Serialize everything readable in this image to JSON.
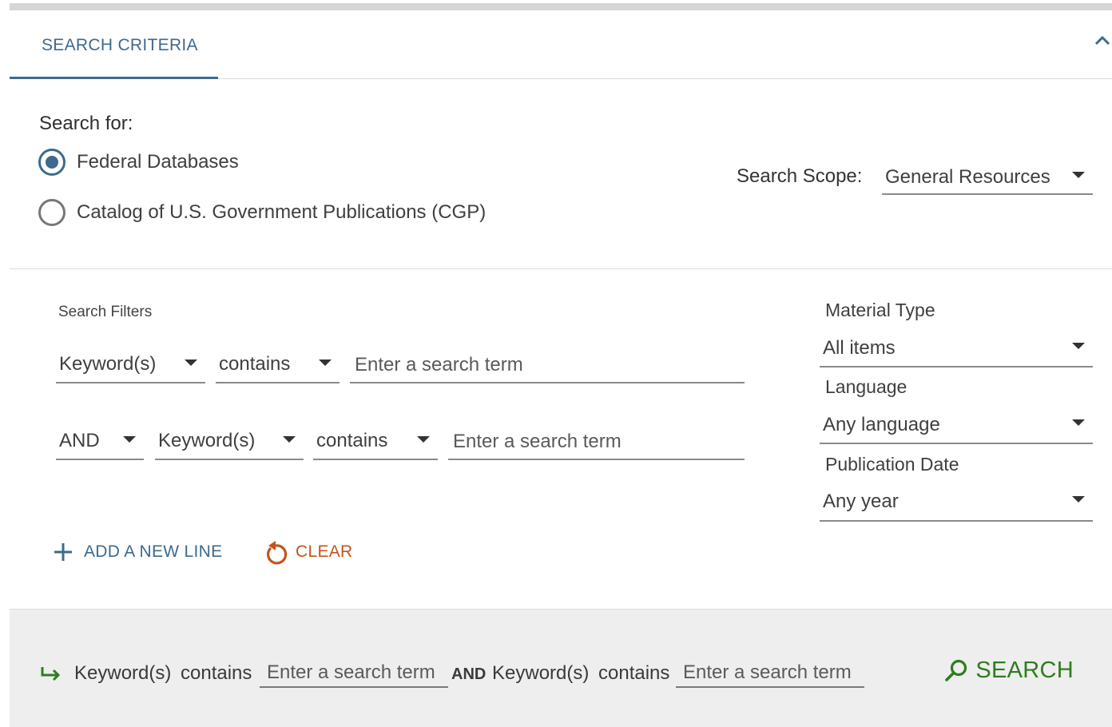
{
  "header": {
    "tab_label": "SEARCH CRITERIA",
    "collapse_icon": "chevron-up-icon"
  },
  "search_for": {
    "label": "Search for:",
    "options": [
      {
        "label": "Federal Databases",
        "checked": true
      },
      {
        "label": "Catalog of U.S. Government Publications (CGP)",
        "checked": false
      }
    ]
  },
  "scope": {
    "label": "Search Scope:",
    "value": "General Resources"
  },
  "filters": {
    "label": "Search Filters",
    "line1": {
      "field": "Keyword(s)",
      "operator": "contains",
      "placeholder": "Enter a search term"
    },
    "line2": {
      "boolean": "AND",
      "field": "Keyword(s)",
      "operator": "contains",
      "placeholder": "Enter a search term"
    }
  },
  "side": {
    "material_type": {
      "label": "Material Type",
      "value": "All items"
    },
    "language": {
      "label": "Language",
      "value": "Any language"
    },
    "publication_date": {
      "label": "Publication Date",
      "value": "Any year"
    }
  },
  "actions": {
    "add_line": "ADD A NEW LINE",
    "clear": "CLEAR"
  },
  "summary": {
    "arrow_icon": "arrow-return-right-icon",
    "field1": "Keyword(s)",
    "op1": "contains",
    "term1": "Enter a search term",
    "boolean": "AND",
    "field2": "Keyword(s)",
    "op2": "contains",
    "term2": "Enter a search term",
    "search_label": "SEARCH"
  },
  "colors": {
    "primary": "#3d6a8e",
    "clear": "#c0561b",
    "search": "#2e7d1e",
    "footer_bg": "#eeeeee"
  }
}
